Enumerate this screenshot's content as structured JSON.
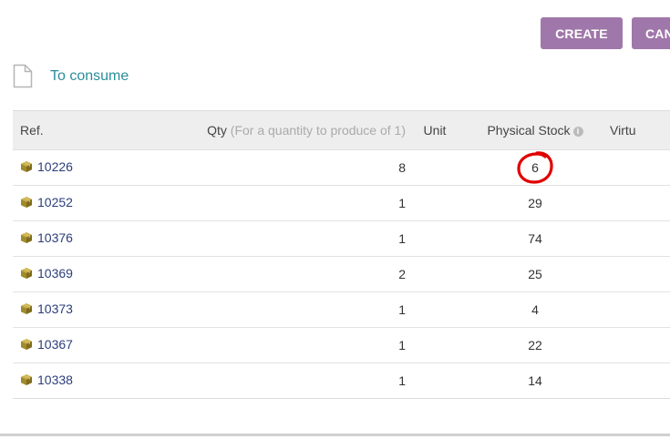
{
  "toolbar": {
    "create_label": "CREATE",
    "cancel_label": "CAN"
  },
  "section": {
    "title": "To consume"
  },
  "table": {
    "headers": {
      "ref": "Ref.",
      "qty": "Qty",
      "qty_hint": "(For a quantity to produce of 1)",
      "unit": "Unit",
      "stock": "Physical Stock",
      "virtual": "Virtu"
    },
    "rows": [
      {
        "ref": "10226",
        "qty": "8",
        "unit": "",
        "stock": "6"
      },
      {
        "ref": "10252",
        "qty": "1",
        "unit": "",
        "stock": "29"
      },
      {
        "ref": "10376",
        "qty": "1",
        "unit": "",
        "stock": "74"
      },
      {
        "ref": "10369",
        "qty": "2",
        "unit": "",
        "stock": "25"
      },
      {
        "ref": "10373",
        "qty": "1",
        "unit": "",
        "stock": "4"
      },
      {
        "ref": "10367",
        "qty": "1",
        "unit": "",
        "stock": "22"
      },
      {
        "ref": "10338",
        "qty": "1",
        "unit": "",
        "stock": "14"
      }
    ]
  },
  "icons": {
    "section": "document-icon",
    "row": "package-icon",
    "stock_info": "info-icon",
    "highlight": "red-circle-annotation"
  },
  "colors": {
    "button": "#a077aa",
    "link": "#2c3e7a",
    "section_title": "#2a8e9b",
    "header_bg": "#eeeeee",
    "package_icon": "#a08a2c",
    "annotation": "#e00000"
  }
}
